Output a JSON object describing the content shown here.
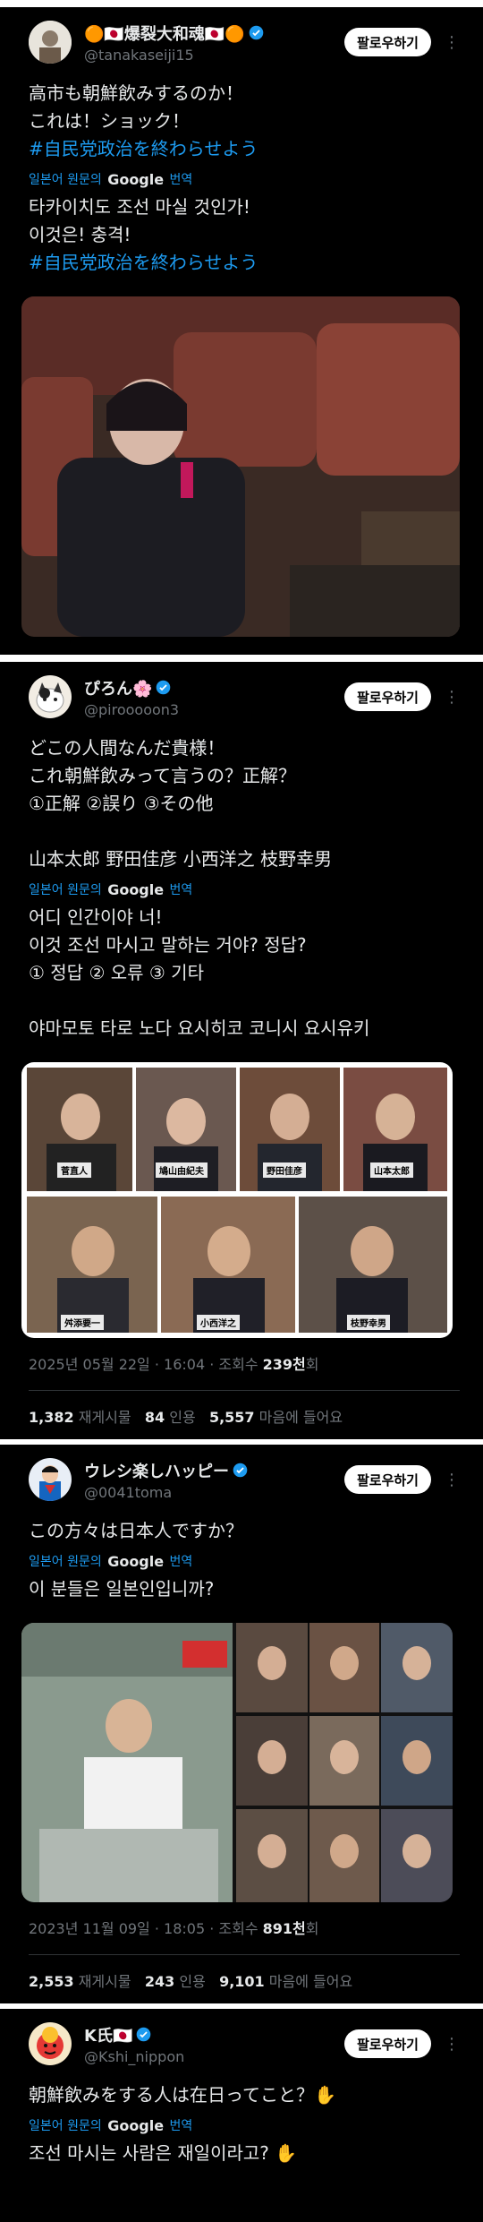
{
  "tweets": [
    {
      "display_name": "🟠🇯🇵爆裂大和魂🇯🇵🟠",
      "handle": "@tanakaseiji15",
      "follow_label": "팔로우하기",
      "original_text": "高市も朝鮮飲みするのか！\nこれは！ショック！",
      "original_hashtag": "#自民党政治を終わらせよう",
      "translate_prefix": "일본어 원문의",
      "translate_brand": "Google",
      "translate_suffix": "번역",
      "translated_text": "타카이치도 조선 마실 것인가!\n이것은! 충격!",
      "translated_hashtag": "#自民党政治を終わらせよう"
    },
    {
      "display_name": "ぴろん🌸",
      "handle": "@pirooooon3",
      "follow_label": "팔로우하기",
      "original_text": "どこの人間なんだ貴様！\nこれ朝鮮飲みって言うの？正解？\n①正解 ②誤り ③その他\n\n山本太郎 野田佳彦 小西洋之 枝野幸男",
      "translate_prefix": "일본어 원문의",
      "translate_brand": "Google",
      "translate_suffix": "번역",
      "translated_text": "어디 인간이야 너!\n이것 조선 마시고 말하는 거야? 정답?\n① 정답 ② 오류 ③ 기타\n\n야마모토 타로 노다 요시히코 코니시 요시유키",
      "photo_captions": [
        "菅直人",
        "鳩山由紀夫",
        "野田佳彦",
        "山本太郎",
        "舛添要一",
        "小西洋之",
        "枝野幸男"
      ],
      "date": "2025년 05월 22일 · 16:04 · 조회수",
      "views": "239천",
      "views_suffix": "회",
      "reposts": "1,382",
      "reposts_label": "재게시물",
      "quotes": "84",
      "quotes_label": "인용",
      "likes": "5,557",
      "likes_label": "마음에 들어요"
    },
    {
      "display_name": "ウレシ楽しハッピー",
      "handle": "@0041toma",
      "follow_label": "팔로우하기",
      "original_text": "この方々は日本人ですか？",
      "translate_prefix": "일본어 원문의",
      "translate_brand": "Google",
      "translate_suffix": "번역",
      "translated_text": "이 분들은 일본인입니까?",
      "date": "2023년 11월 09일 · 18:05 · 조회수",
      "views": "891천",
      "views_suffix": "회",
      "reposts": "2,553",
      "reposts_label": "재게시물",
      "quotes": "243",
      "quotes_label": "인용",
      "likes": "9,101",
      "likes_label": "마음에 들어요"
    },
    {
      "display_name": "K氏🇯🇵",
      "handle": "@Kshi_nippon",
      "follow_label": "팔로우하기",
      "original_text": "朝鮮飲みをする人は在日ってこと？✋",
      "translate_prefix": "일본어 원문의",
      "translate_brand": "Google",
      "translate_suffix": "번역",
      "translated_text": "조선 마시는 사람은 재일이라고? ✋"
    }
  ],
  "colors": {
    "link": "#1d9bf0",
    "muted": "#71767b",
    "text": "#e7e9ea",
    "verified": "#1d9bf0"
  }
}
